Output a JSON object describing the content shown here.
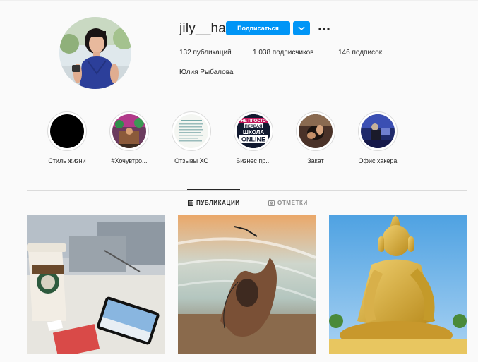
{
  "profile": {
    "username": "jily__ha",
    "follow_label": "Подписаться",
    "stats": {
      "posts": "132 публикаций",
      "followers": "1 038 подписчиков",
      "following": "146 подписок"
    },
    "full_name": "Юлия Рыбалова"
  },
  "highlights": [
    {
      "label": "Стиль жизни"
    },
    {
      "label": "#Хочувтро..."
    },
    {
      "label": "Отзывы ХС"
    },
    {
      "label": "Бизнес пр...",
      "cover_text": [
        "НЕ ПРОСТО",
        "ПЕРВАЯ",
        "ШКОЛА",
        "ONLINE"
      ]
    },
    {
      "label": "Закат"
    },
    {
      "label": "Офис хакера"
    }
  ],
  "tabs": {
    "posts_label": "ПУБЛИКАЦИИ",
    "tagged_label": "ОТМЕТКИ"
  },
  "colors": {
    "accent": "#0095f6",
    "text": "#262626",
    "muted": "#8e8e8e",
    "background": "#fafafa",
    "border": "#dbdbdb"
  },
  "icons": {
    "dropdown": "chevron-down-icon",
    "more": "more-options-icon",
    "posts_tab": "grid-icon",
    "tagged_tab": "tagged-icon"
  }
}
